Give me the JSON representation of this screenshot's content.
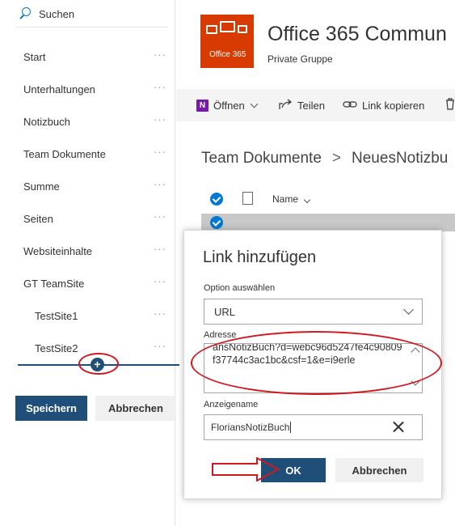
{
  "sidebar": {
    "search_label": "Suchen",
    "items": [
      {
        "label": "Start",
        "dots": "···"
      },
      {
        "label": "Unterhaltungen",
        "dots": "···"
      },
      {
        "label": "Notizbuch",
        "dots": "···"
      },
      {
        "label": "Team Dokumente",
        "dots": "···"
      },
      {
        "label": "Summe",
        "dots": "···"
      },
      {
        "label": "Seiten",
        "dots": "···"
      },
      {
        "label": "Websiteinhalte",
        "dots": "···"
      },
      {
        "label": "GT TeamSite",
        "dots": "···"
      },
      {
        "label": "TestSite1",
        "dots": "···"
      },
      {
        "label": "TestSite2",
        "dots": "···"
      }
    ],
    "insert_symbol": "+",
    "save_label": "Speichern",
    "cancel_label": "Abbrechen"
  },
  "header": {
    "logo_text": "Office 365",
    "title": "Office 365 Commun",
    "subtitle": "Private Gruppe"
  },
  "toolbar": {
    "open_icon_letter": "N",
    "open_label": "Öffnen",
    "share_label": "Teilen",
    "copy_link_label": "Link kopieren"
  },
  "breadcrumb": {
    "parent": "Team Dokumente",
    "separator": ">",
    "current": "NeuesNotizbu"
  },
  "list": {
    "name_column": "Name"
  },
  "dialog": {
    "title": "Link hinzufügen",
    "option_label": "Option auswählen",
    "option_value": "URL",
    "address_label": "Adresse",
    "address_value": "ansNotizBuch?d=webc96d5247fe4c90809f37744c3ac1bc&csf=1&e=i9erle",
    "display_name_label": "Anzeigename",
    "display_name_value": "FloriansNotizBuch",
    "ok_label": "OK",
    "cancel_label": "Abbrechen"
  },
  "colors": {
    "accent": "#1f4e79",
    "brand": "#d83b01",
    "annotation": "#d0191f"
  }
}
